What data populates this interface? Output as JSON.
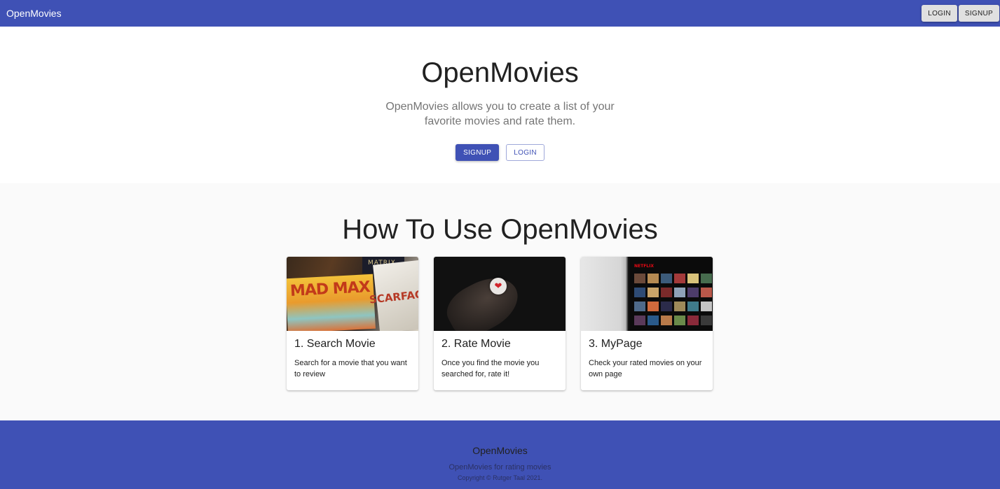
{
  "appbar": {
    "brand": "OpenMovies",
    "login_label": "LOGIN",
    "signup_label": "SIGNUP"
  },
  "hero": {
    "title": "OpenMovies",
    "tagline": "OpenMovies allows you to create a list of your favorite movies and rate them.",
    "signup_label": "SIGNUP",
    "login_label": "LOGIN"
  },
  "howto": {
    "heading": "How To Use OpenMovies",
    "cards": [
      {
        "title": "1. Search Movie",
        "text": "Search for a movie that you want to review",
        "image": "movie-posters-image"
      },
      {
        "title": "2. Rate Movie",
        "text": "Once you find the movie you searched for, rate it!",
        "image": "heart-pin-image"
      },
      {
        "title": "3. MyPage",
        "text": "Check your rated movies on your own page",
        "image": "streaming-screen-image"
      }
    ],
    "image_text": {
      "mad_max": "MAD MAX",
      "scarface": "SCARFAC",
      "matrix": "MATRIX",
      "netflix": "NETFLIX",
      "heart": "❤"
    }
  },
  "footer": {
    "title": "OpenMovies",
    "subtitle": "OpenMovies for rating movies",
    "copyright": "Copyright © Rutger Taal 2021."
  },
  "colors": {
    "primary": "#3f51b5",
    "surface": "#ffffff",
    "background": "#fafafa",
    "muted_text": "#757575"
  }
}
